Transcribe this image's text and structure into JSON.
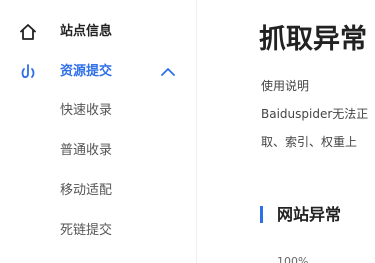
{
  "sidebar": {
    "items": [
      {
        "label": "站点信息",
        "icon": "home-icon",
        "active": false
      },
      {
        "label": "资源提交",
        "icon": "resource-submit-icon",
        "active": true,
        "expanded": true,
        "children": [
          "快速收录",
          "普通收录",
          "移动适配",
          "死链提交"
        ]
      }
    ],
    "accent_color": "#2f6fe8"
  },
  "main": {
    "title": "抓取异常",
    "help_label": "使用说明",
    "description_lines": [
      "Baiduspider无法正",
      "取、索引、权重上"
    ],
    "section_title": "网站异常",
    "chart_axis_label": "100%"
  }
}
